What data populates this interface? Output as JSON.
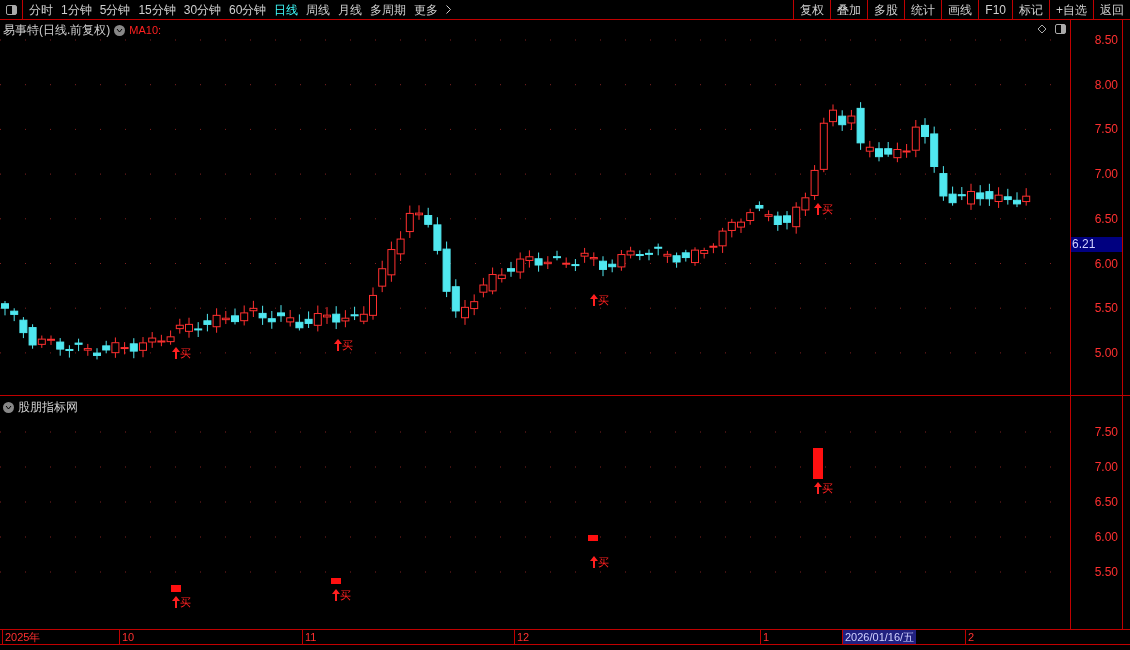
{
  "toolbar": {
    "tabs": [
      {
        "label": "分时",
        "selected": false
      },
      {
        "label": "1分钟",
        "selected": false
      },
      {
        "label": "5分钟",
        "selected": false
      },
      {
        "label": "15分钟",
        "selected": false
      },
      {
        "label": "30分钟",
        "selected": false
      },
      {
        "label": "60分钟",
        "selected": false
      },
      {
        "label": "日线",
        "selected": true
      },
      {
        "label": "周线",
        "selected": false
      },
      {
        "label": "月线",
        "selected": false
      },
      {
        "label": "多周期",
        "selected": false
      },
      {
        "label": "更多",
        "selected": false
      }
    ],
    "buttons": [
      "复权",
      "叠加",
      "多股",
      "统计",
      "画线",
      "F10",
      "标记",
      "+自选",
      "返回"
    ]
  },
  "main_panel": {
    "title": "易事特(日线.前复权)",
    "indicator": "MA10:",
    "price_ticks": [
      "8.50",
      "8.00",
      "7.50",
      "7.00",
      "6.50",
      "6.00",
      "5.50",
      "5.00"
    ],
    "current_price": "6.21",
    "signals": [
      {
        "label": "买"
      },
      {
        "label": "买"
      },
      {
        "label": "买"
      },
      {
        "label": "买"
      }
    ]
  },
  "lower_panel": {
    "title": "股朋指标网",
    "ticks": [
      "7.50",
      "7.00",
      "6.50",
      "6.00",
      "5.50"
    ],
    "signals": [
      {
        "label": "买"
      },
      {
        "label": "买"
      },
      {
        "label": "买"
      },
      {
        "label": "买"
      }
    ]
  },
  "date_axis": {
    "labels": [
      {
        "text": "2025年",
        "selected": false
      },
      {
        "text": "10",
        "selected": false
      },
      {
        "text": "11",
        "selected": false
      },
      {
        "text": "12",
        "selected": false
      },
      {
        "text": "1",
        "selected": false
      },
      {
        "text": "2026/01/16/五",
        "selected": true
      },
      {
        "text": "2",
        "selected": false
      }
    ]
  }
}
